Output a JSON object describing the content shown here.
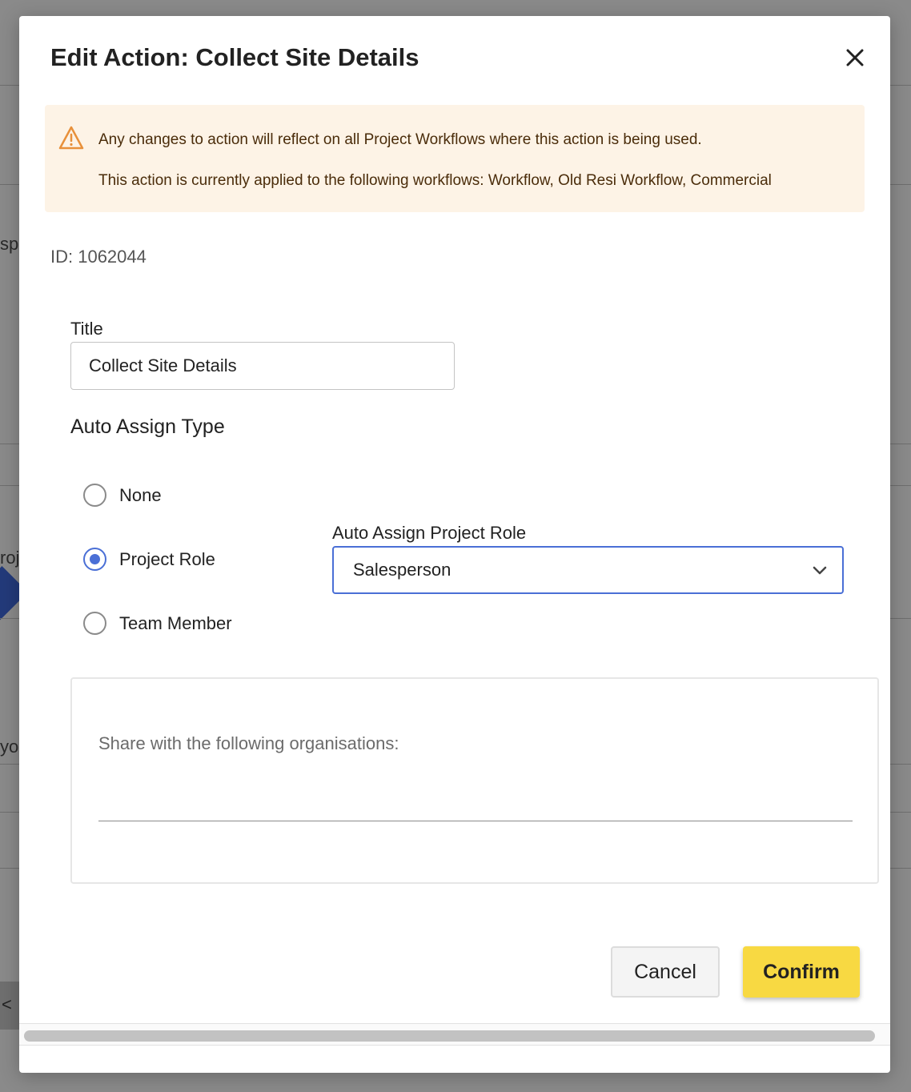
{
  "background": {
    "fragments": [
      "spe",
      "roje",
      "yo",
      "<"
    ]
  },
  "modal": {
    "title": "Edit Action: Collect Site Details",
    "close_icon": "close-icon"
  },
  "warning": {
    "icon": "warning-triangle-icon",
    "line1": "Any changes to action will reflect on all Project Workflows where this action is being used.",
    "line2": "This action is currently applied to the following workflows: Workflow, Old Resi Workflow, Commercial"
  },
  "id_text": "ID: 1062044",
  "form": {
    "title_label": "Title",
    "title_value": "Collect Site Details",
    "auto_assign_label": "Auto Assign Type",
    "options": [
      {
        "label": "None",
        "checked": false
      },
      {
        "label": "Project Role",
        "checked": true
      },
      {
        "label": "Team Member",
        "checked": false
      }
    ],
    "role_label": "Auto Assign Project Role",
    "role_value": "Salesperson",
    "share_placeholder": "Share with the following organisations:"
  },
  "actions": {
    "cancel_label": "Cancel",
    "confirm_label": "Confirm"
  },
  "colors": {
    "accent": "#4a6fd6",
    "confirm": "#f8d942",
    "warning_bg": "#fdf3e6",
    "warning_icon": "#e8903a"
  }
}
